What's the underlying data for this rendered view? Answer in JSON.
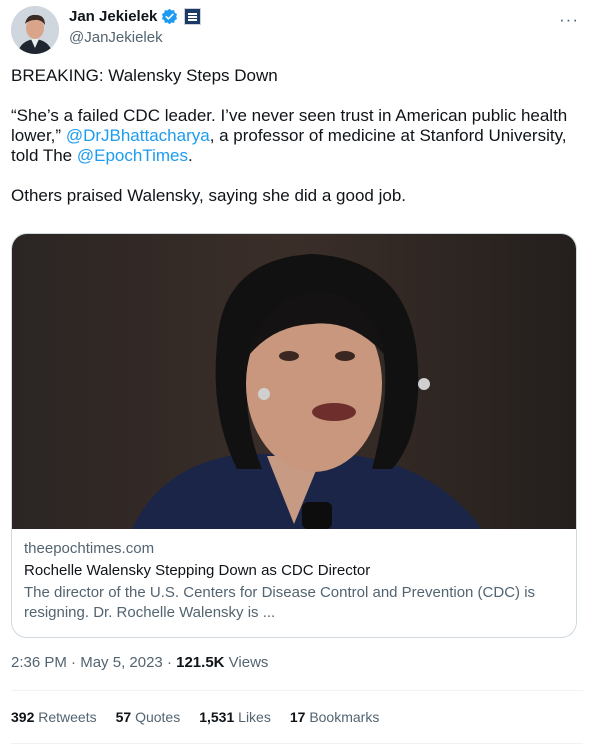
{
  "author": {
    "display_name": "Jan Jekielek",
    "handle": "@JanJekielek",
    "verified_icon": "verified-badge-icon",
    "affiliation_icon": "epoch-times-logo-icon"
  },
  "tweet": {
    "line1": "BREAKING: Walensky Steps Down",
    "quote_start": "“She’s a failed CDC leader. I’ve never seen trust in American public health lower,”",
    "mention1": "@DrJBhattacharya",
    "quote_mid": ", a professor of medicine at Stanford University, told The",
    "mention2": "@EpochTimes",
    "quote_end": ".",
    "line3": "Others praised Walensky, saying she did a good job."
  },
  "card": {
    "domain": "theepochtimes.com",
    "title": "Rochelle Walensky Stepping Down as CDC Director",
    "description": "The director of the U.S. Centers for Disease Control and Prevention (CDC) is resigning. Dr. Rochelle Walensky is ..."
  },
  "meta": {
    "time": "2:36 PM",
    "sep": "·",
    "date": "May 5, 2023",
    "views_count": "121.5K",
    "views_label": "Views"
  },
  "stats": {
    "retweets": {
      "count": "392",
      "label": "Retweets"
    },
    "quotes": {
      "count": "57",
      "label": "Quotes"
    },
    "likes": {
      "count": "1,531",
      "label": "Likes"
    },
    "bookmarks": {
      "count": "17",
      "label": "Bookmarks"
    }
  },
  "colors": {
    "accent": "#1d9bf0",
    "secondary_text": "#536471",
    "border": "#cfd9de"
  }
}
